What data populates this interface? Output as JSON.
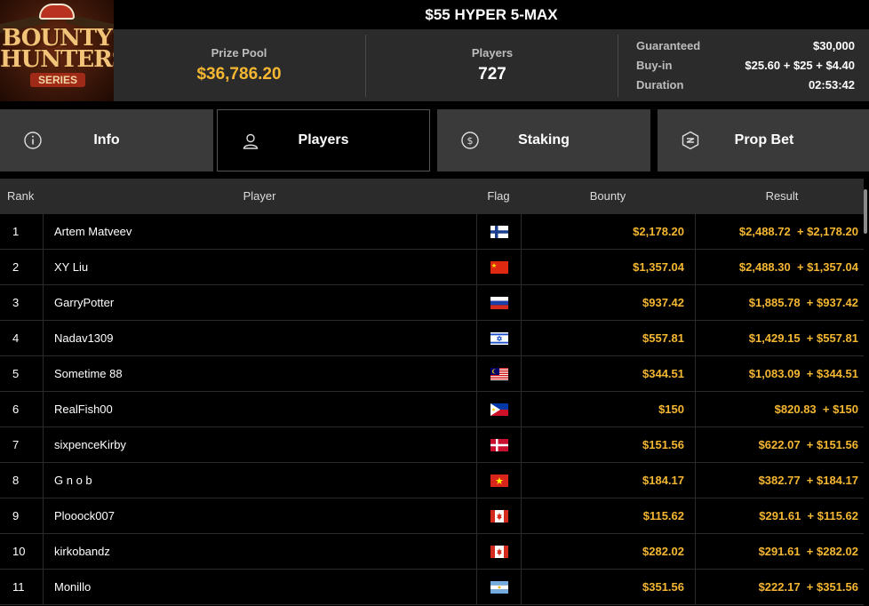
{
  "logo": {
    "line1": "BOUNTY",
    "line2": "HUNTERS",
    "line3": "SERIES"
  },
  "header": {
    "title": "$55 HYPER 5-MAX",
    "prize_pool_label": "Prize Pool",
    "prize_pool_value": "$36,786.20",
    "players_label": "Players",
    "players_value": "727",
    "details": [
      {
        "label": "Guaranteed",
        "value": "$30,000"
      },
      {
        "label": "Buy-in",
        "value": "$25.60 + $25 + $4.40"
      },
      {
        "label": "Duration",
        "value": "02:53:42"
      }
    ]
  },
  "tabs": [
    {
      "label": "Info",
      "icon": "info-icon"
    },
    {
      "label": "Players",
      "icon": "user-icon",
      "active": true
    },
    {
      "label": "Staking",
      "icon": "dollar-coin-icon"
    },
    {
      "label": "Prop Bet",
      "icon": "prop-bet-icon"
    }
  ],
  "table": {
    "columns": {
      "rank": "Rank",
      "player": "Player",
      "flag": "Flag",
      "bounty": "Bounty",
      "result": "Result"
    },
    "rows": [
      {
        "rank": "1",
        "player": "Artem Matveev",
        "flag": "finland",
        "bounty": "$2,178.20",
        "result": "$2,488.72  + $2,178.20"
      },
      {
        "rank": "2",
        "player": "XY Liu",
        "flag": "china",
        "bounty": "$1,357.04",
        "result": "$2,488.30  + $1,357.04"
      },
      {
        "rank": "3",
        "player": "GarryPotter",
        "flag": "russia",
        "bounty": "$937.42",
        "result": "$1,885.78  + $937.42"
      },
      {
        "rank": "4",
        "player": "Nadav1309",
        "flag": "israel",
        "bounty": "$557.81",
        "result": "$1,429.15  + $557.81"
      },
      {
        "rank": "5",
        "player": "Sometime 88",
        "flag": "malaysia",
        "bounty": "$344.51",
        "result": "$1,083.09  + $344.51"
      },
      {
        "rank": "6",
        "player": "RealFish00",
        "flag": "philippines",
        "bounty": "$150",
        "result": "$820.83  + $150"
      },
      {
        "rank": "7",
        "player": "sixpenceKirby",
        "flag": "denmark",
        "bounty": "$151.56",
        "result": "$622.07  + $151.56"
      },
      {
        "rank": "8",
        "player": "G n o b",
        "flag": "vietnam",
        "bounty": "$184.17",
        "result": "$382.77  + $184.17"
      },
      {
        "rank": "9",
        "player": "Plooock007",
        "flag": "canada",
        "bounty": "$115.62",
        "result": "$291.61  + $115.62"
      },
      {
        "rank": "10",
        "player": "kirkobandz",
        "flag": "canada",
        "bounty": "$282.02",
        "result": "$291.61  + $282.02"
      },
      {
        "rank": "11",
        "player": "Monillo",
        "flag": "argentina",
        "bounty": "$351.56",
        "result": "$222.17  + $351.56"
      }
    ]
  }
}
